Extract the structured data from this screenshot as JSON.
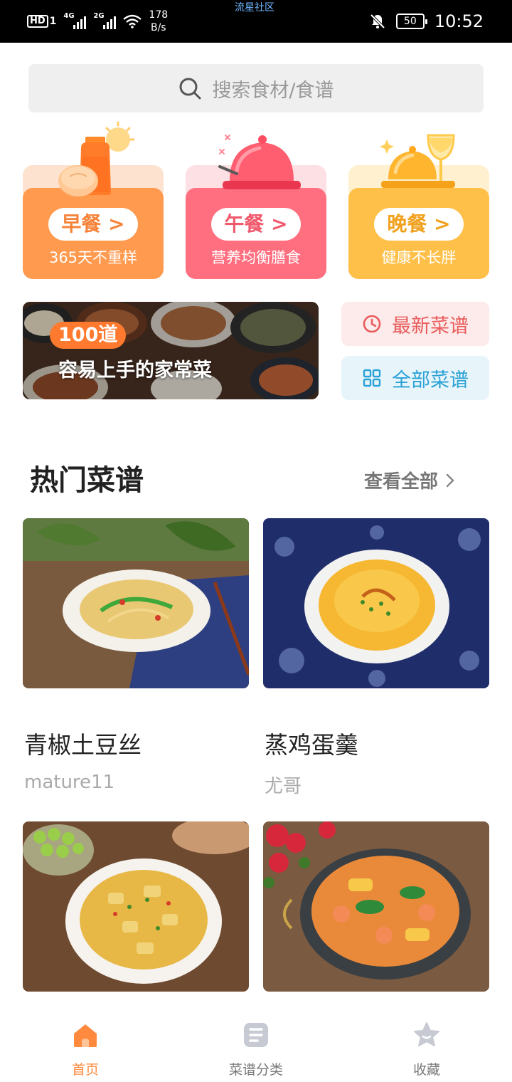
{
  "status_bar": {
    "hd": "HD",
    "sim": "1",
    "net1": "4G",
    "net2": "2G",
    "speed_value": "178",
    "speed_unit": "B/s",
    "community": "流星社区",
    "battery": "50",
    "time": "10:52"
  },
  "search": {
    "placeholder": "搜索食材/食谱"
  },
  "meals": [
    {
      "label": "早餐 >",
      "subtitle": "365天不重样",
      "color": "#ff9a4f",
      "text_color": "#f5833a"
    },
    {
      "label": "午餐 >",
      "subtitle": "营养均衡膳食",
      "color": "#ff6f7f",
      "text_color": "#f0586c"
    },
    {
      "label": "晚餐 >",
      "subtitle": "健康不长胖",
      "color": "#ffc04a",
      "text_color": "#f1a11e"
    }
  ],
  "promo": {
    "badge": "100道",
    "text": "容易上手的家常菜"
  },
  "quick_links": {
    "latest": "最新菜谱",
    "all": "全部菜谱"
  },
  "hot_section": {
    "title": "热门菜谱",
    "more": "查看全部"
  },
  "recipes": [
    {
      "title": "青椒土豆丝",
      "author": "mature11"
    },
    {
      "title": "蒸鸡蛋羹",
      "author": "尤哥"
    },
    {
      "title": "",
      "author": ""
    },
    {
      "title": "",
      "author": ""
    }
  ],
  "tabbar": {
    "items": [
      {
        "label": "首页",
        "active": true
      },
      {
        "label": "菜谱分类",
        "active": false
      },
      {
        "label": "收藏",
        "active": false
      }
    ],
    "active_color": "#ff8a3d",
    "inactive_color": "#777777"
  }
}
